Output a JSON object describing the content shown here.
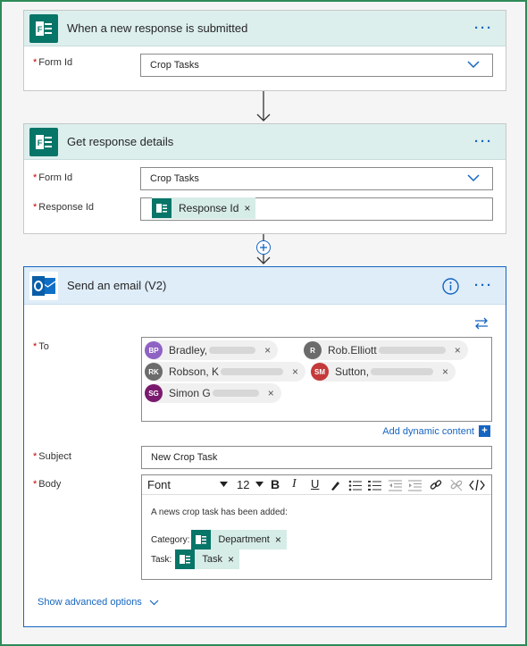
{
  "card1": {
    "title": "When a new response is submitted",
    "more": "···",
    "form_label": "Form Id",
    "form_value": "Crop Tasks"
  },
  "card2": {
    "title": "Get response details",
    "more": "···",
    "form_label": "Form Id",
    "form_value": "Crop Tasks",
    "response_label": "Response Id",
    "response_token": "Response Id",
    "token_remove": "×"
  },
  "card3": {
    "title": "Send an email (V2)",
    "more": "···",
    "to_label": "To",
    "recipients": [
      {
        "initials": "BP",
        "name": "Bradley, ",
        "color": "#8e63c4"
      },
      {
        "initials": "R",
        "name": "Rob.Elliott",
        "color": "#6b6b6b"
      },
      {
        "initials": "RK",
        "name": "Robson, K",
        "color": "#6b6b6b"
      },
      {
        "initials": "SM",
        "name": "Sutton, ",
        "color": "#c43a3a"
      },
      {
        "initials": "SG",
        "name": "Simon G",
        "color": "#7a1a6e"
      }
    ],
    "remove": "×",
    "add_dynamic": "Add dynamic content",
    "add_dynamic_icon": "+",
    "subject_label": "Subject",
    "subject_value": "New Crop Task",
    "body_label": "Body",
    "toolbar": {
      "font": "Font",
      "size": "12",
      "bold": "B",
      "italic": "I",
      "underline": "U"
    },
    "body_text": "A news crop task has been added:",
    "category_label": "Category:",
    "category_token": "Department",
    "task_label": "Task:",
    "task_token": "Task",
    "show_advanced": "Show advanced options"
  },
  "colors": {
    "forms_green": "#077568",
    "outlook_blue": "#0f6fc6",
    "link_blue": "#1565c0",
    "header_teal": "#dcefed",
    "header_blue": "#dfedf8"
  }
}
